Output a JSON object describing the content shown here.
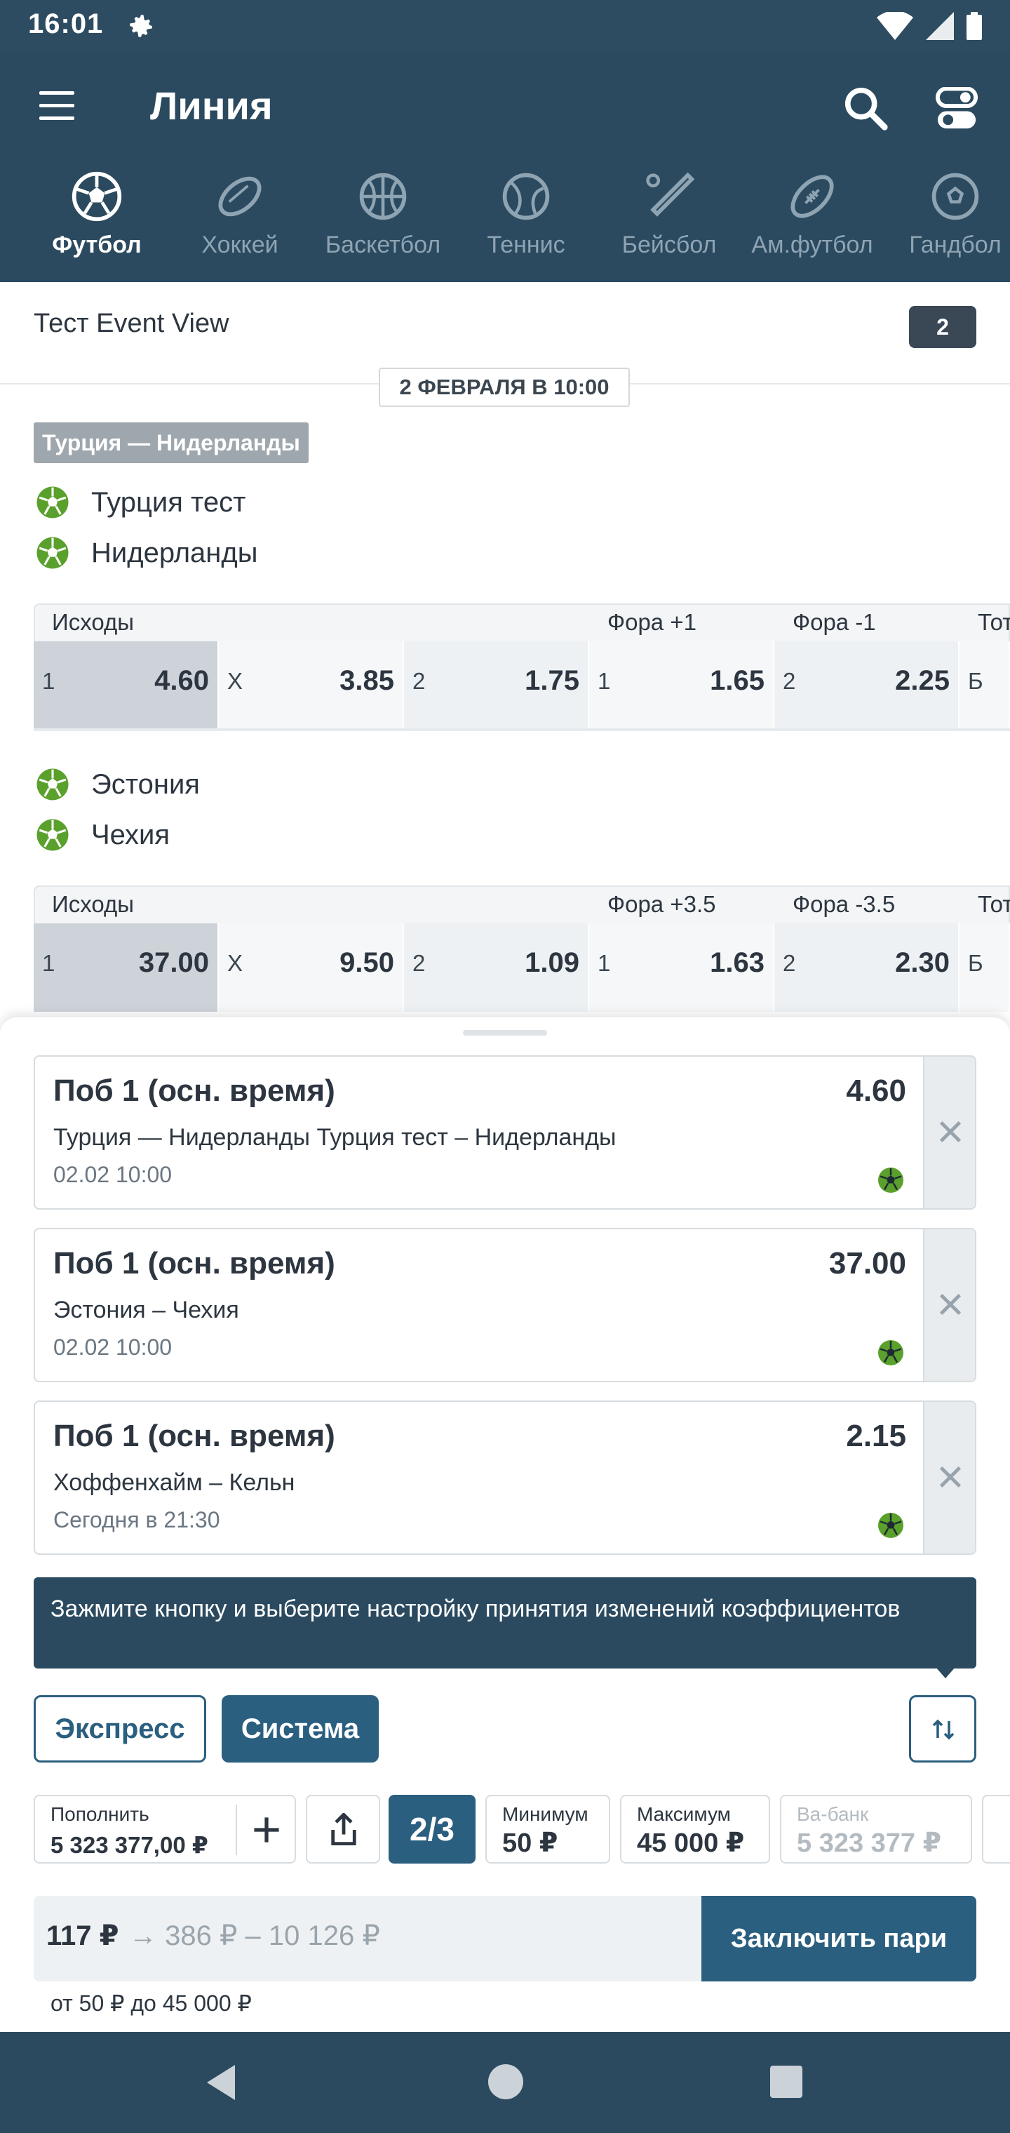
{
  "status_bar": {
    "time": "16:01"
  },
  "header": {
    "title": "Линия"
  },
  "sports": [
    {
      "label": "Футбол",
      "icon": "football-icon",
      "active": true
    },
    {
      "label": "Хоккей",
      "icon": "hockey-icon"
    },
    {
      "label": "Баскетбол",
      "icon": "basketball-icon"
    },
    {
      "label": "Теннис",
      "icon": "tennis-icon"
    },
    {
      "label": "Бейсбол",
      "icon": "baseball-icon"
    },
    {
      "label": "Ам.футбол",
      "icon": "american-football-icon"
    },
    {
      "label": "Гандбол",
      "icon": "handball-icon"
    }
  ],
  "section": {
    "title": "Тест Event View",
    "badge": "2"
  },
  "date_chip": "2 ФЕВРАЛЯ В 10:00",
  "league": "Турция — Нидерланды",
  "events": [
    {
      "team1": "Турция тест",
      "team2": "Нидерланды",
      "headers": {
        "outcomes": "Исходы",
        "h1": "Фора +1",
        "h2": "Фора -1",
        "total": "Тот"
      },
      "cells": [
        {
          "label": "1",
          "value": "4.60"
        },
        {
          "label": "X",
          "value": "3.85"
        },
        {
          "label": "2",
          "value": "1.75"
        },
        {
          "label": "1",
          "value": "1.65"
        },
        {
          "label": "2",
          "value": "2.25"
        },
        {
          "label": "Б",
          "value": ""
        }
      ]
    },
    {
      "team1": "Эстония",
      "team2": "Чехия",
      "headers": {
        "outcomes": "Исходы",
        "h1": "Фора +3.5",
        "h2": "Фора -3.5",
        "total": "Тот"
      },
      "cells": [
        {
          "label": "1",
          "value": "37.00"
        },
        {
          "label": "X",
          "value": "9.50"
        },
        {
          "label": "2",
          "value": "1.09"
        },
        {
          "label": "1",
          "value": "1.63"
        },
        {
          "label": "2",
          "value": "2.30"
        },
        {
          "label": "Б",
          "value": ""
        }
      ]
    }
  ],
  "bets": [
    {
      "name": "Поб 1 (осн. время)",
      "odd": "4.60",
      "match": "Турция — Нидерланды Турция тест – Нидерланды",
      "time": "02.02 10:00"
    },
    {
      "name": "Поб 1 (осн. время)",
      "odd": "37.00",
      "match": "Эстония – Чехия",
      "time": "02.02 10:00"
    },
    {
      "name": "Поб 1 (осн. время)",
      "odd": "2.15",
      "match": "Хоффенхайм – Кельн",
      "time": "Сегодня в 21:30"
    }
  ],
  "tooltip": "Зажмите кнопку и выберите настройку принятия изменений коэффициентов",
  "bet_types": {
    "express": "Экспресс",
    "system": "Система"
  },
  "quick": {
    "deposit_label": "Пополнить",
    "deposit_value": "5 323 377,00 ₽",
    "system_value": "2/3",
    "min_label": "Минимум",
    "min_value": "50 ₽",
    "max_label": "Максимум",
    "max_value": "45 000 ₽",
    "allin_label": "Ва-банк",
    "allin_value": "5 323 377 ₽"
  },
  "stake": {
    "amount": "117 ₽",
    "range": "→ 386 ₽ – 10 126 ₽",
    "place_label": "Заключить пари",
    "limits": "от 50 ₽ до 45 000 ₽"
  },
  "colors": {
    "primary": "#2b4a5f",
    "accent": "#2b5f80",
    "ball": "#5aa02c"
  }
}
